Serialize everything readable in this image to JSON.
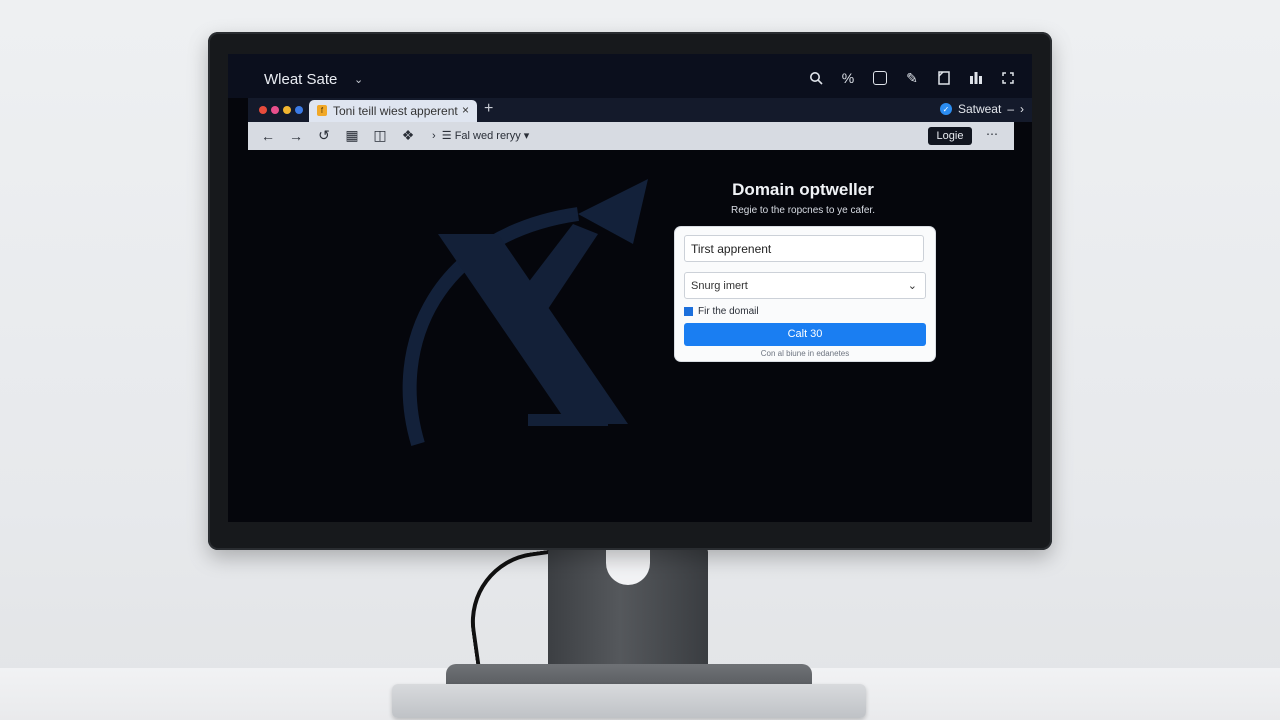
{
  "app": {
    "title": "Wleat Sate"
  },
  "tab": {
    "title": "Toni teill wiest apperent"
  },
  "account": {
    "label": "Satweat"
  },
  "address": {
    "breadcrumb": "Fal wed reryy"
  },
  "login": {
    "label": "Logie"
  },
  "form": {
    "heading": "Domain optweller",
    "subtitle": "Regie to the ropcnes to ye cafer.",
    "input_value": "Tirst apprenent",
    "select_value": "Snurg imert",
    "checkbox_label": "Fir the domail",
    "checkbox_checked": true,
    "submit_label": "Calt 30",
    "footnote": "Con al biune in edanetes"
  },
  "colors": {
    "accent": "#1a7ef2",
    "screen_bg": "#05060c",
    "logo": "#1a2a44"
  },
  "icons": [
    "search-icon",
    "percent-icon",
    "box-icon",
    "pencil-icon",
    "copy-icon",
    "grid-icon",
    "expand-icon"
  ]
}
